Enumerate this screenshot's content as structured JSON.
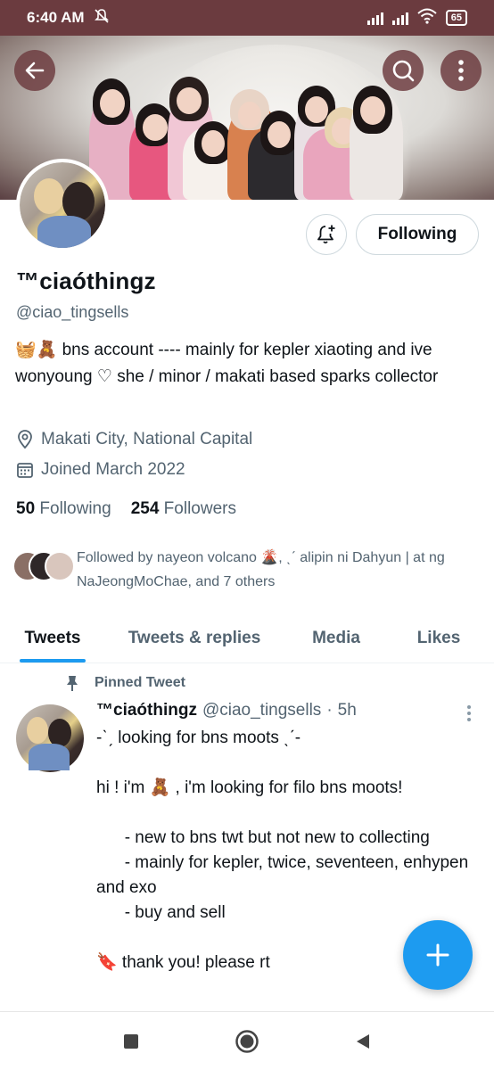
{
  "status_bar": {
    "time": "6:40 AM",
    "battery": "65",
    "icons": [
      "mute-icon",
      "signal-icon",
      "signal-icon",
      "wifi-icon",
      "battery-icon"
    ]
  },
  "top_bar": {
    "back_icon": "arrow-left-icon",
    "search_icon": "search-icon",
    "more_icon": "more-vertical-icon"
  },
  "profile": {
    "display_name": "™ciaóthingz",
    "handle": "@ciao_tingsells",
    "bio": "🧺🧸 bns account ---- mainly for kepler xiaoting and ive wonyoung ♡ she / minor / makati based  sparks collector",
    "location": "Makati City, National Capital",
    "joined": "Joined March 2022",
    "following_count": "50",
    "following_label": "Following",
    "followers_count": "254",
    "followers_label": "Followers",
    "followed_by": "Followed by nayeon volcano 🌋, ˎˊ alipin ni Dahyun | at ng NaJeongMoChae, and 7 others"
  },
  "actions": {
    "notify_icon": "bell-plus-icon",
    "follow_button": "Following"
  },
  "tabs": [
    {
      "label": "Tweets",
      "active": true
    },
    {
      "label": "Tweets & replies",
      "active": false
    },
    {
      "label": "Media",
      "active": false
    },
    {
      "label": "Likes",
      "active": false
    }
  ],
  "pinned_tweet": {
    "pinned_label": "Pinned Tweet",
    "author_name": "™ciaóthingz",
    "author_handle": "@ciao_tingsells",
    "separator": "·",
    "time": "5h",
    "body": "-ˋˏ looking for bns moots ˎˊ-\n\nhi ! i'm 🧸 , i'm looking for filo bns moots!\n\n      - new to bns twt but not new to collecting\n      - mainly for kepler, twice, seventeen, enhypen and exo\n      - buy and sell\n\n🔖 thank you! please rt"
  },
  "fab": {
    "icon": "plus-icon"
  },
  "nav_bar": {
    "icons": [
      "recents-icon",
      "home-icon",
      "back-triangle-icon"
    ]
  },
  "colors": {
    "status_bar": "#6b3b3f",
    "accent": "#1d9bf0",
    "text_primary": "#0f1419",
    "text_secondary": "#536471"
  }
}
